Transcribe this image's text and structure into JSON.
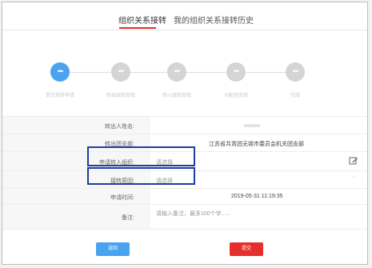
{
  "tabs": {
    "active": "组织关系接转",
    "history": "我的组织关系接转历史"
  },
  "steps": [
    {
      "label": "提交接转申请",
      "icon": "ellipsis-icon",
      "active": true
    },
    {
      "label": "转出组织审批",
      "icon": "ellipsis-icon",
      "active": false
    },
    {
      "label": "转入组织审批",
      "icon": "ellipsis-icon",
      "active": false
    },
    {
      "label": "分配团支部",
      "icon": "ellipsis-icon",
      "active": false
    },
    {
      "label": "完成",
      "icon": "ellipsis-icon",
      "active": false
    }
  ],
  "form": {
    "transfer_out_name_label": "转出人姓名:",
    "transfer_out_branch_label": "转出团支部:",
    "transfer_out_branch_value": "江苏省共青团无锡市委员会机关团支部",
    "apply_in_org_label": "申请转入组织:",
    "apply_in_org_placeholder": "请选择",
    "reason_label": "接转原因:",
    "reason_placeholder": "请选择",
    "apply_time_label": "申请时间:",
    "apply_time_value": "2019-05-31 11:19:35",
    "remark_label": "备注:",
    "remark_placeholder": "请输入备注，最多100个字......"
  },
  "buttons": {
    "back": "返回",
    "submit": "提交"
  },
  "colors": {
    "accent": "#4aa3f0",
    "tab_underline": "#e0312b",
    "submit": "#e52f2f",
    "highlight_box": "#1c3fa0"
  }
}
